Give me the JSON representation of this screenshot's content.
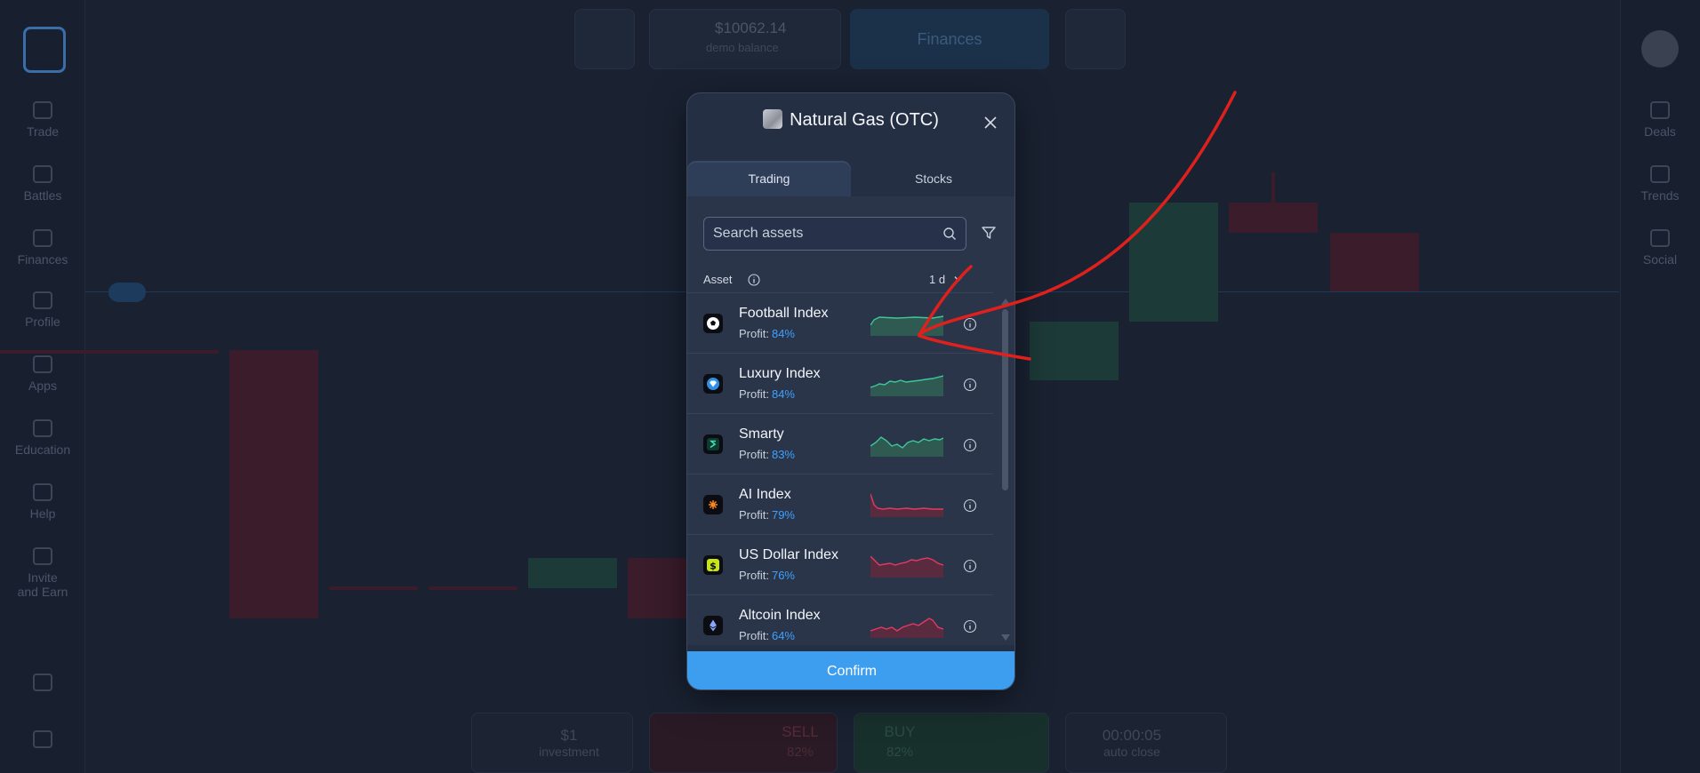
{
  "background": {
    "left_rail": [
      {
        "label": "Trade",
        "icon": "chart-icon"
      },
      {
        "label": "Battles",
        "icon": "trophy-icon"
      },
      {
        "label": "Finances",
        "icon": "wallet-icon"
      },
      {
        "label": "Profile",
        "icon": "user-icon"
      },
      {
        "label": "Apps",
        "icon": "apps-icon"
      },
      {
        "label": "Education",
        "icon": "book-icon"
      },
      {
        "label": "Help",
        "icon": "help-icon"
      },
      {
        "label": "Invite and Earn",
        "icon": "heart-icon"
      }
    ],
    "right_rail": [
      {
        "label": "Deals",
        "icon": "deals-icon"
      },
      {
        "label": "Trends",
        "icon": "bolt-icon"
      },
      {
        "label": "Social",
        "icon": "social-icon"
      }
    ],
    "balance_amount": "$10062.14",
    "balance_label": "demo balance",
    "finances_label": "Finances",
    "investment_value": "$1",
    "investment_label": "investment",
    "sell_label": "SELL",
    "sell_pct": "82%",
    "buy_label": "BUY",
    "buy_pct": "82%",
    "timer_value": "00:00:05",
    "timer_label": "auto close"
  },
  "modal": {
    "title": "Natural Gas (OTC)",
    "tabs": [
      "Trading",
      "Stocks"
    ],
    "search_placeholder": "Search assets",
    "column_asset": "Asset",
    "period": "1 d",
    "profit_label": "Profit:",
    "assets": [
      {
        "name": "Football Index",
        "profit": "84%",
        "trend": "up",
        "icon": "football-icon"
      },
      {
        "name": "Luxury Index",
        "profit": "84%",
        "trend": "up",
        "icon": "diamond-icon"
      },
      {
        "name": "Smarty",
        "profit": "83%",
        "trend": "up",
        "icon": "smarty-icon"
      },
      {
        "name": "AI Index",
        "profit": "79%",
        "trend": "down",
        "icon": "ai-icon"
      },
      {
        "name": "US Dollar Index",
        "profit": "76%",
        "trend": "down",
        "icon": "dollar-icon"
      },
      {
        "name": "Altcoin Index",
        "profit": "64%",
        "trend": "down",
        "icon": "ethereum-icon"
      }
    ],
    "confirm_label": "Confirm"
  },
  "colors": {
    "accent": "#3d9ef0",
    "profit_text": "#3ea1ff",
    "up_trend": "#3fc79a",
    "down_trend": "#e23a63",
    "annotation_stroke": "#e0201c"
  }
}
